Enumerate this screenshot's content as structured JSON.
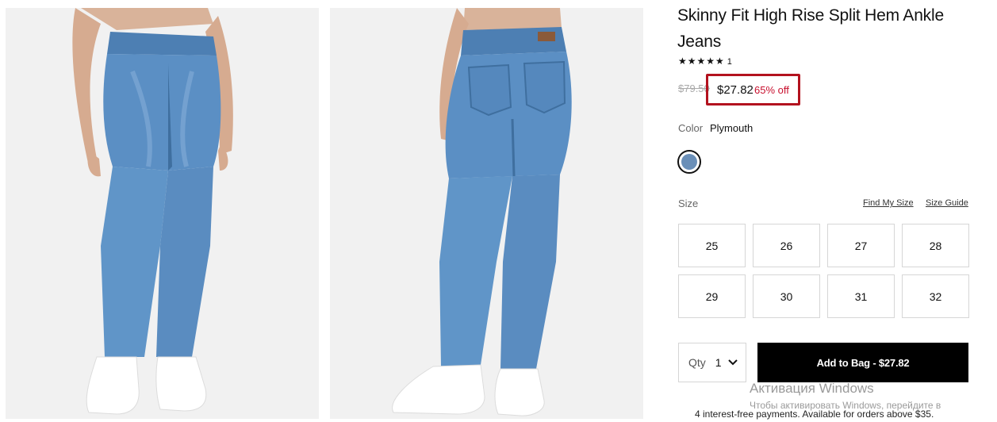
{
  "product": {
    "title": "Skinny Fit High Rise Split Hem Ankle Jeans",
    "rating_stars": "★★★★★",
    "rating_count": "1",
    "price_original": "$79.50",
    "price_current": "$27.82",
    "discount": "65% off"
  },
  "color": {
    "label": "Color",
    "value": "Plymouth",
    "swatch_hex": "#6a8fb8"
  },
  "size": {
    "label": "Size",
    "find_my_size": "Find My Size",
    "size_guide": "Size Guide",
    "options": [
      "25",
      "26",
      "27",
      "28",
      "29",
      "30",
      "31",
      "32"
    ]
  },
  "purchase": {
    "qty_label": "Qty",
    "qty_value": "1",
    "add_to_bag": "Add to Bag  -  $27.82",
    "installments": "4 interest-free payments. Available for orders above $35."
  },
  "watermark": {
    "line1": "Активация Windows",
    "line2": "Чтобы активировать Windows, перейдите в"
  },
  "icons": {
    "qty_dropdown": "chevron-down-icon",
    "rating": "star-icon"
  },
  "colors": {
    "highlight_border": "#b3121e",
    "discount_text": "#c8102e",
    "button_bg": "#000000"
  }
}
